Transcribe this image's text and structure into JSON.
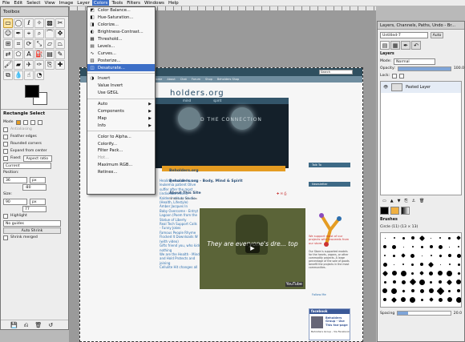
{
  "menubar": {
    "items": [
      "File",
      "Edit",
      "Select",
      "View",
      "Image",
      "Layer",
      "Colors",
      "Tools",
      "Filters",
      "Windows",
      "Help"
    ],
    "active": "Colors"
  },
  "toolbox": {
    "title": "Toolbox",
    "gimp_label": "Wilber",
    "tool_options_title": "Rectangle Select",
    "mode_label": "Mode",
    "antialiasing_label": "Antialiasing",
    "feather_label": "Feather edges",
    "rounded_label": "Rounded corners",
    "expand_label": "Expand from center",
    "fixed_label": "Fixed:",
    "fixed_value": "Aspect ratio",
    "current_value": "Current",
    "position_label": "Position:",
    "position_x": "36",
    "position_y": "-80",
    "position_unit": "px",
    "size_label": "Size:",
    "size_w": "90",
    "size_h": "77",
    "size_unit": "px",
    "highlight_label": "Highlight",
    "guides_value": "No guides",
    "autoshrink_label": "Auto Shrink",
    "shrink_merged_label": "Shrink merged"
  },
  "colors_menu": {
    "items": [
      {
        "label": "Color Balance...",
        "icon": "color-balance-icon",
        "glyph": "◩"
      },
      {
        "label": "Hue-Saturation...",
        "icon": "hue-saturation-icon",
        "glyph": "◧"
      },
      {
        "label": "Colorize...",
        "icon": "colorize-icon",
        "glyph": "◨"
      },
      {
        "label": "Brightness-Contrast...",
        "icon": "brightness-contrast-icon",
        "glyph": "◐"
      },
      {
        "label": "Threshold...",
        "icon": "threshold-icon",
        "glyph": "▦"
      },
      {
        "label": "Levels...",
        "icon": "levels-icon",
        "glyph": "▤"
      },
      {
        "label": "Curves...",
        "icon": "curves-icon",
        "glyph": "∿"
      },
      {
        "label": "Posterize...",
        "icon": "posterize-icon",
        "glyph": "▥"
      },
      {
        "label": "Desaturate...",
        "icon": "desaturate-icon",
        "glyph": "◫"
      },
      {
        "label": "Invert",
        "icon": "invert-icon",
        "glyph": "◑"
      },
      {
        "label": "Value Invert",
        "icon": "",
        "glyph": ""
      },
      {
        "label": "Use GEGL",
        "icon": "",
        "glyph": ""
      },
      {
        "label": "Auto",
        "icon": "",
        "glyph": "",
        "sub": true
      },
      {
        "label": "Components",
        "icon": "",
        "glyph": "",
        "sub": true
      },
      {
        "label": "Map",
        "icon": "",
        "glyph": "",
        "sub": true
      },
      {
        "label": "Info",
        "icon": "",
        "glyph": "",
        "sub": true
      },
      {
        "label": "Color to Alpha...",
        "icon": "",
        "glyph": ""
      },
      {
        "label": "Colorify...",
        "icon": "",
        "glyph": ""
      },
      {
        "label": "Filter Pack...",
        "icon": "",
        "glyph": ""
      },
      {
        "label": "Hot...",
        "icon": "",
        "glyph": "",
        "dim": true
      },
      {
        "label": "Maximum RGB...",
        "icon": "",
        "glyph": ""
      },
      {
        "label": "Retinex...",
        "icon": "",
        "glyph": ""
      }
    ],
    "selected": "Desaturate..."
  },
  "website": {
    "search_placeholder": "Search",
    "nav": [
      "Home",
      "About",
      "Chat",
      "Forum",
      "Shop",
      "Beholders Shop"
    ],
    "logo_text": "holders.org",
    "banner_nav": [
      "mind",
      "spirit"
    ],
    "banner_text": "D THE CONNECTION",
    "post_section_title": "Beholders.org",
    "post_title": "Beholders.org - Body, Mind & Spirit",
    "about_title": "About This Site",
    "posted_by": "Written by Tom Bow",
    "left_links": [
      "Healing recount from a",
      "leukemia patient Olive",
      "suffer after the most",
      "(individual Intent)",
      "Kalder Institute Studio",
      "(Health, Lifestyle)",
      "Amber Jacques In",
      "Baby Overcome - Entryt",
      "Lagoon (Poem from the",
      "Statue of Liberty",
      "Real Tech Support Calls",
      "- Funny Jokes",
      "Famous People Rhyme",
      "Flocked It Downloads W",
      "(with video)",
      "Gifts friend you, who kids",
      "nothing",
      "We are the Health - Minds",
      "and Hold Protects and",
      "joining",
      "Cellulite Hit changes all"
    ],
    "video_caption": "They are everyone's dre... top",
    "youtube": "YouTube",
    "right_heads": [
      "Talk To",
      "Newsletter",
      "Follow Me"
    ],
    "right_red_text": "We support most of our projects with proceeds from our store.",
    "right_small_text": "Our Store is supported models for the hearts, organs, or other commodity projects. A large percentage of the sale of goods benefit the projects in the most communities.",
    "facebook_title": "facebook",
    "facebook_name": "Beholders Group - Use This fan-page",
    "facebook_text": "Beholders Group - Via Facebook"
  },
  "dock": {
    "title": "Layers, Channels, Paths, Undo - Br...",
    "image_select": "Untitled-7",
    "auto_label": "Auto",
    "layers_label": "Layers",
    "mode_label": "Mode:",
    "mode_value": "Normal",
    "opacity_label": "Opacity:",
    "opacity_value": "100.0",
    "lock_label": "Lock:",
    "layer_name": "Pasted Layer",
    "brushes_label": "Brushes",
    "brush_name": "Circle (11) (13 × 13)",
    "spacing_label": "Spacing",
    "spacing_value": "20.0"
  },
  "colors": {
    "accent": "#3d6fc7",
    "orange": "#e59c22",
    "banner": "#14202a"
  }
}
